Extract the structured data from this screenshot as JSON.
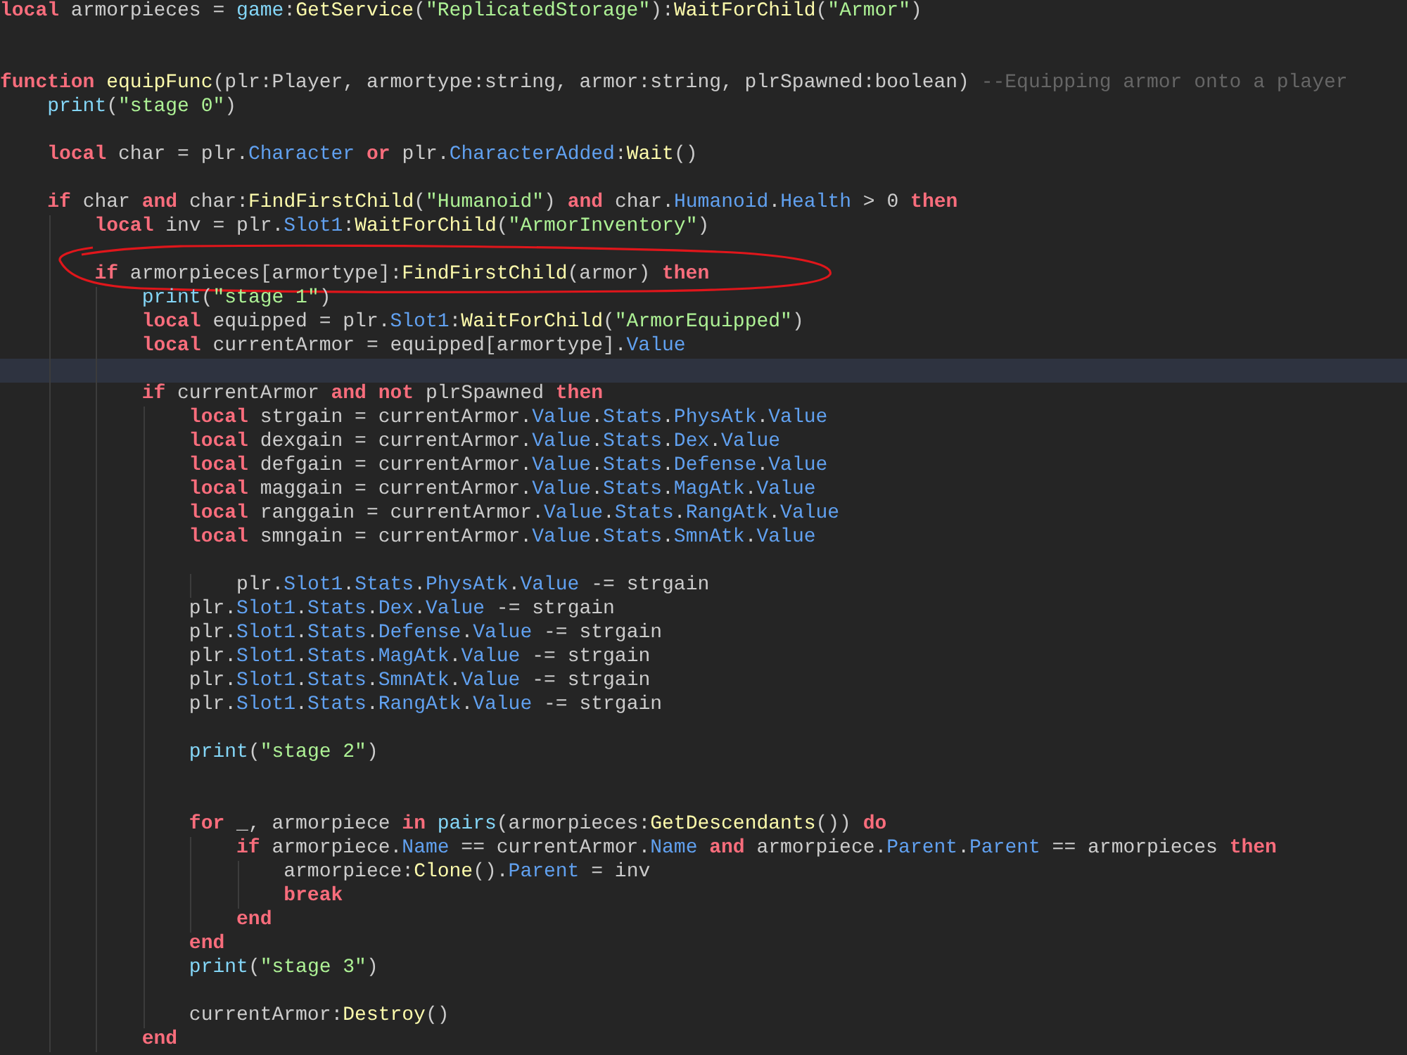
{
  "editor": {
    "lines": [
      {
        "current": false,
        "annotated": false,
        "tokens": [
          {
            "kind": "keyword",
            "text": "local"
          },
          {
            "kind": "plain",
            "text": " armorpieces = "
          },
          {
            "kind": "builtin",
            "text": "game"
          },
          {
            "kind": "plain",
            "text": ":"
          },
          {
            "kind": "function",
            "text": "GetService"
          },
          {
            "kind": "plain",
            "text": "("
          },
          {
            "kind": "string",
            "text": "\"ReplicatedStorage\""
          },
          {
            "kind": "plain",
            "text": "):"
          },
          {
            "kind": "function",
            "text": "WaitForChild"
          },
          {
            "kind": "plain",
            "text": "("
          },
          {
            "kind": "string",
            "text": "\"Armor\""
          },
          {
            "kind": "plain",
            "text": ")"
          }
        ]
      },
      {
        "current": false,
        "annotated": false
      },
      {
        "current": false,
        "annotated": false
      },
      {
        "current": false,
        "annotated": false,
        "tokens": [
          {
            "kind": "keyword",
            "text": "function "
          },
          {
            "kind": "function",
            "text": "equipFunc"
          },
          {
            "kind": "plain",
            "text": "(plr:Player, armortype:string, armor:string, plrSpawned:boolean) "
          },
          {
            "kind": "comment",
            "text": "--Equipping armor onto a player"
          }
        ]
      },
      {
        "current": false,
        "annotated": false,
        "tokens": [
          {
            "kind": "builtin",
            "text": "    print"
          },
          {
            "kind": "plain",
            "text": "("
          },
          {
            "kind": "string",
            "text": "\"stage 0\""
          },
          {
            "kind": "plain",
            "text": ")"
          }
        ]
      },
      {
        "current": false,
        "annotated": false
      },
      {
        "current": false,
        "annotated": false,
        "tokens": [
          {
            "kind": "keyword",
            "text": "    local"
          },
          {
            "kind": "plain",
            "text": " char = plr."
          },
          {
            "kind": "property",
            "text": "Character"
          },
          {
            "kind": "keyword",
            "text": " or"
          },
          {
            "kind": "plain",
            "text": " plr."
          },
          {
            "kind": "property",
            "text": "CharacterAdded"
          },
          {
            "kind": "plain",
            "text": ":"
          },
          {
            "kind": "function",
            "text": "Wait"
          },
          {
            "kind": "plain",
            "text": "()"
          }
        ]
      },
      {
        "current": false,
        "annotated": false
      },
      {
        "current": false,
        "annotated": false,
        "tokens": [
          {
            "kind": "keyword",
            "text": "    if"
          },
          {
            "kind": "plain",
            "text": " char "
          },
          {
            "kind": "keyword",
            "text": "and"
          },
          {
            "kind": "plain",
            "text": " char:"
          },
          {
            "kind": "function",
            "text": "FindFirstChild"
          },
          {
            "kind": "plain",
            "text": "("
          },
          {
            "kind": "string",
            "text": "\"Humanoid\""
          },
          {
            "kind": "plain",
            "text": ") "
          },
          {
            "kind": "keyword",
            "text": "and"
          },
          {
            "kind": "plain",
            "text": " char."
          },
          {
            "kind": "property",
            "text": "Humanoid"
          },
          {
            "kind": "plain",
            "text": "."
          },
          {
            "kind": "property",
            "text": "Health"
          },
          {
            "kind": "plain",
            "text": " > 0 "
          },
          {
            "kind": "keyword",
            "text": "then"
          }
        ]
      },
      {
        "current": false,
        "annotated": false,
        "tokens": [
          {
            "kind": "keyword",
            "text": "        local"
          },
          {
            "kind": "plain",
            "text": " inv = plr."
          },
          {
            "kind": "property",
            "text": "Slot1"
          },
          {
            "kind": "plain",
            "text": ":"
          },
          {
            "kind": "function",
            "text": "WaitForChild"
          },
          {
            "kind": "plain",
            "text": "("
          },
          {
            "kind": "string",
            "text": "\"ArmorInventory\""
          },
          {
            "kind": "plain",
            "text": ")"
          }
        ]
      },
      {
        "current": false,
        "annotated": false
      },
      {
        "current": false,
        "annotated": true,
        "tokens": [
          {
            "kind": "keyword",
            "text": "        if"
          },
          {
            "kind": "plain",
            "text": " armorpieces[armortype]:"
          },
          {
            "kind": "function",
            "text": "FindFirstChild"
          },
          {
            "kind": "plain",
            "text": "(armor) "
          },
          {
            "kind": "keyword",
            "text": "then"
          }
        ]
      },
      {
        "current": false,
        "annotated": false,
        "tokens": [
          {
            "kind": "builtin",
            "text": "            print"
          },
          {
            "kind": "plain",
            "text": "("
          },
          {
            "kind": "string",
            "text": "\"stage 1\""
          },
          {
            "kind": "plain",
            "text": ")"
          }
        ]
      },
      {
        "current": false,
        "annotated": false,
        "tokens": [
          {
            "kind": "keyword",
            "text": "            local"
          },
          {
            "kind": "plain",
            "text": " equipped = plr."
          },
          {
            "kind": "property",
            "text": "Slot1"
          },
          {
            "kind": "plain",
            "text": ":"
          },
          {
            "kind": "function",
            "text": "WaitForChild"
          },
          {
            "kind": "plain",
            "text": "("
          },
          {
            "kind": "string",
            "text": "\"ArmorEquipped\""
          },
          {
            "kind": "plain",
            "text": ")"
          }
        ]
      },
      {
        "current": false,
        "annotated": false,
        "tokens": [
          {
            "kind": "keyword",
            "text": "            local"
          },
          {
            "kind": "plain",
            "text": " currentArmor = equipped[armortype]."
          },
          {
            "kind": "property",
            "text": "Value"
          }
        ]
      },
      {
        "current": true,
        "annotated": false
      },
      {
        "current": false,
        "annotated": false,
        "tokens": [
          {
            "kind": "keyword",
            "text": "            if"
          },
          {
            "kind": "plain",
            "text": " currentArmor "
          },
          {
            "kind": "keyword",
            "text": "and not"
          },
          {
            "kind": "plain",
            "text": " plrSpawned "
          },
          {
            "kind": "keyword",
            "text": "then"
          }
        ]
      },
      {
        "current": false,
        "annotated": false,
        "tokens": [
          {
            "kind": "keyword",
            "text": "                local"
          },
          {
            "kind": "plain",
            "text": " strgain = currentArmor."
          },
          {
            "kind": "property",
            "text": "Value"
          },
          {
            "kind": "plain",
            "text": "."
          },
          {
            "kind": "property",
            "text": "Stats"
          },
          {
            "kind": "plain",
            "text": "."
          },
          {
            "kind": "property",
            "text": "PhysAtk"
          },
          {
            "kind": "plain",
            "text": "."
          },
          {
            "kind": "property",
            "text": "Value"
          }
        ]
      },
      {
        "current": false,
        "annotated": false,
        "tokens": [
          {
            "kind": "keyword",
            "text": "                local"
          },
          {
            "kind": "plain",
            "text": " dexgain = currentArmor."
          },
          {
            "kind": "property",
            "text": "Value"
          },
          {
            "kind": "plain",
            "text": "."
          },
          {
            "kind": "property",
            "text": "Stats"
          },
          {
            "kind": "plain",
            "text": "."
          },
          {
            "kind": "property",
            "text": "Dex"
          },
          {
            "kind": "plain",
            "text": "."
          },
          {
            "kind": "property",
            "text": "Value"
          }
        ]
      },
      {
        "current": false,
        "annotated": false,
        "tokens": [
          {
            "kind": "keyword",
            "text": "                local"
          },
          {
            "kind": "plain",
            "text": " defgain = currentArmor."
          },
          {
            "kind": "property",
            "text": "Value"
          },
          {
            "kind": "plain",
            "text": "."
          },
          {
            "kind": "property",
            "text": "Stats"
          },
          {
            "kind": "plain",
            "text": "."
          },
          {
            "kind": "property",
            "text": "Defense"
          },
          {
            "kind": "plain",
            "text": "."
          },
          {
            "kind": "property",
            "text": "Value"
          }
        ]
      },
      {
        "current": false,
        "annotated": false,
        "tokens": [
          {
            "kind": "keyword",
            "text": "                local"
          },
          {
            "kind": "plain",
            "text": " maggain = currentArmor."
          },
          {
            "kind": "property",
            "text": "Value"
          },
          {
            "kind": "plain",
            "text": "."
          },
          {
            "kind": "property",
            "text": "Stats"
          },
          {
            "kind": "plain",
            "text": "."
          },
          {
            "kind": "property",
            "text": "MagAtk"
          },
          {
            "kind": "plain",
            "text": "."
          },
          {
            "kind": "property",
            "text": "Value"
          }
        ]
      },
      {
        "current": false,
        "annotated": false,
        "tokens": [
          {
            "kind": "keyword",
            "text": "                local"
          },
          {
            "kind": "plain",
            "text": " ranggain = currentArmor."
          },
          {
            "kind": "property",
            "text": "Value"
          },
          {
            "kind": "plain",
            "text": "."
          },
          {
            "kind": "property",
            "text": "Stats"
          },
          {
            "kind": "plain",
            "text": "."
          },
          {
            "kind": "property",
            "text": "RangAtk"
          },
          {
            "kind": "plain",
            "text": "."
          },
          {
            "kind": "property",
            "text": "Value"
          }
        ]
      },
      {
        "current": false,
        "annotated": false,
        "tokens": [
          {
            "kind": "keyword",
            "text": "                local"
          },
          {
            "kind": "plain",
            "text": " smngain = currentArmor."
          },
          {
            "kind": "property",
            "text": "Value"
          },
          {
            "kind": "plain",
            "text": "."
          },
          {
            "kind": "property",
            "text": "Stats"
          },
          {
            "kind": "plain",
            "text": "."
          },
          {
            "kind": "property",
            "text": "SmnAtk"
          },
          {
            "kind": "plain",
            "text": "."
          },
          {
            "kind": "property",
            "text": "Value"
          }
        ]
      },
      {
        "current": false,
        "annotated": false
      },
      {
        "current": false,
        "annotated": false,
        "tokens": [
          {
            "kind": "plain",
            "text": "                    plr."
          },
          {
            "kind": "property",
            "text": "Slot1"
          },
          {
            "kind": "plain",
            "text": "."
          },
          {
            "kind": "property",
            "text": "Stats"
          },
          {
            "kind": "plain",
            "text": "."
          },
          {
            "kind": "property",
            "text": "PhysAtk"
          },
          {
            "kind": "plain",
            "text": "."
          },
          {
            "kind": "property",
            "text": "Value"
          },
          {
            "kind": "plain",
            "text": " -= strgain"
          }
        ]
      },
      {
        "current": false,
        "annotated": false,
        "tokens": [
          {
            "kind": "plain",
            "text": "                plr."
          },
          {
            "kind": "property",
            "text": "Slot1"
          },
          {
            "kind": "plain",
            "text": "."
          },
          {
            "kind": "property",
            "text": "Stats"
          },
          {
            "kind": "plain",
            "text": "."
          },
          {
            "kind": "property",
            "text": "Dex"
          },
          {
            "kind": "plain",
            "text": "."
          },
          {
            "kind": "property",
            "text": "Value"
          },
          {
            "kind": "plain",
            "text": " -= strgain"
          }
        ]
      },
      {
        "current": false,
        "annotated": false,
        "tokens": [
          {
            "kind": "plain",
            "text": "                plr."
          },
          {
            "kind": "property",
            "text": "Slot1"
          },
          {
            "kind": "plain",
            "text": "."
          },
          {
            "kind": "property",
            "text": "Stats"
          },
          {
            "kind": "plain",
            "text": "."
          },
          {
            "kind": "property",
            "text": "Defense"
          },
          {
            "kind": "plain",
            "text": "."
          },
          {
            "kind": "property",
            "text": "Value"
          },
          {
            "kind": "plain",
            "text": " -= strgain"
          }
        ]
      },
      {
        "current": false,
        "annotated": false,
        "tokens": [
          {
            "kind": "plain",
            "text": "                plr."
          },
          {
            "kind": "property",
            "text": "Slot1"
          },
          {
            "kind": "plain",
            "text": "."
          },
          {
            "kind": "property",
            "text": "Stats"
          },
          {
            "kind": "plain",
            "text": "."
          },
          {
            "kind": "property",
            "text": "MagAtk"
          },
          {
            "kind": "plain",
            "text": "."
          },
          {
            "kind": "property",
            "text": "Value"
          },
          {
            "kind": "plain",
            "text": " -= strgain"
          }
        ]
      },
      {
        "current": false,
        "annotated": false,
        "tokens": [
          {
            "kind": "plain",
            "text": "                plr."
          },
          {
            "kind": "property",
            "text": "Slot1"
          },
          {
            "kind": "plain",
            "text": "."
          },
          {
            "kind": "property",
            "text": "Stats"
          },
          {
            "kind": "plain",
            "text": "."
          },
          {
            "kind": "property",
            "text": "SmnAtk"
          },
          {
            "kind": "plain",
            "text": "."
          },
          {
            "kind": "property",
            "text": "Value"
          },
          {
            "kind": "plain",
            "text": " -= strgain"
          }
        ]
      },
      {
        "current": false,
        "annotated": false,
        "tokens": [
          {
            "kind": "plain",
            "text": "                plr."
          },
          {
            "kind": "property",
            "text": "Slot1"
          },
          {
            "kind": "plain",
            "text": "."
          },
          {
            "kind": "property",
            "text": "Stats"
          },
          {
            "kind": "plain",
            "text": "."
          },
          {
            "kind": "property",
            "text": "RangAtk"
          },
          {
            "kind": "plain",
            "text": "."
          },
          {
            "kind": "property",
            "text": "Value"
          },
          {
            "kind": "plain",
            "text": " -= strgain"
          }
        ]
      },
      {
        "current": false,
        "annotated": false
      },
      {
        "current": false,
        "annotated": false,
        "tokens": [
          {
            "kind": "builtin",
            "text": "                print"
          },
          {
            "kind": "plain",
            "text": "("
          },
          {
            "kind": "string",
            "text": "\"stage 2\""
          },
          {
            "kind": "plain",
            "text": ")"
          }
        ]
      },
      {
        "current": false,
        "annotated": false
      },
      {
        "current": false,
        "annotated": false
      },
      {
        "current": false,
        "annotated": false,
        "tokens": [
          {
            "kind": "keyword",
            "text": "                for"
          },
          {
            "kind": "plain",
            "text": " _, armorpiece "
          },
          {
            "kind": "keyword",
            "text": "in"
          },
          {
            "kind": "builtin",
            "text": " pairs"
          },
          {
            "kind": "plain",
            "text": "(armorpieces:"
          },
          {
            "kind": "function",
            "text": "GetDescendants"
          },
          {
            "kind": "plain",
            "text": "()) "
          },
          {
            "kind": "keyword",
            "text": "do"
          }
        ]
      },
      {
        "current": false,
        "annotated": false,
        "tokens": [
          {
            "kind": "keyword",
            "text": "                    if"
          },
          {
            "kind": "plain",
            "text": " armorpiece."
          },
          {
            "kind": "property",
            "text": "Name"
          },
          {
            "kind": "plain",
            "text": " == currentArmor."
          },
          {
            "kind": "property",
            "text": "Name"
          },
          {
            "kind": "keyword",
            "text": " and"
          },
          {
            "kind": "plain",
            "text": " armorpiece."
          },
          {
            "kind": "property",
            "text": "Parent"
          },
          {
            "kind": "plain",
            "text": "."
          },
          {
            "kind": "property",
            "text": "Parent"
          },
          {
            "kind": "plain",
            "text": " == armorpieces "
          },
          {
            "kind": "keyword",
            "text": "then"
          }
        ]
      },
      {
        "current": false,
        "annotated": false,
        "tokens": [
          {
            "kind": "plain",
            "text": "                        armorpiece:"
          },
          {
            "kind": "function",
            "text": "Clone"
          },
          {
            "kind": "plain",
            "text": "()."
          },
          {
            "kind": "property",
            "text": "Parent"
          },
          {
            "kind": "plain",
            "text": " = inv"
          }
        ]
      },
      {
        "current": false,
        "annotated": false,
        "tokens": [
          {
            "kind": "keyword",
            "text": "                        break"
          }
        ]
      },
      {
        "current": false,
        "annotated": false,
        "tokens": [
          {
            "kind": "keyword",
            "text": "                    end"
          }
        ]
      },
      {
        "current": false,
        "annotated": false,
        "tokens": [
          {
            "kind": "keyword",
            "text": "                end"
          }
        ]
      },
      {
        "current": false,
        "annotated": false,
        "tokens": [
          {
            "kind": "builtin",
            "text": "                print"
          },
          {
            "kind": "plain",
            "text": "("
          },
          {
            "kind": "string",
            "text": "\"stage 3\""
          },
          {
            "kind": "plain",
            "text": ")"
          }
        ]
      },
      {
        "current": false,
        "annotated": false
      },
      {
        "current": false,
        "annotated": false,
        "tokens": [
          {
            "kind": "plain",
            "text": "                currentArmor:"
          },
          {
            "kind": "function",
            "text": "Destroy"
          },
          {
            "kind": "plain",
            "text": "()"
          }
        ]
      },
      {
        "current": false,
        "annotated": false,
        "tokens": [
          {
            "kind": "keyword",
            "text": "            end"
          }
        ]
      }
    ]
  }
}
